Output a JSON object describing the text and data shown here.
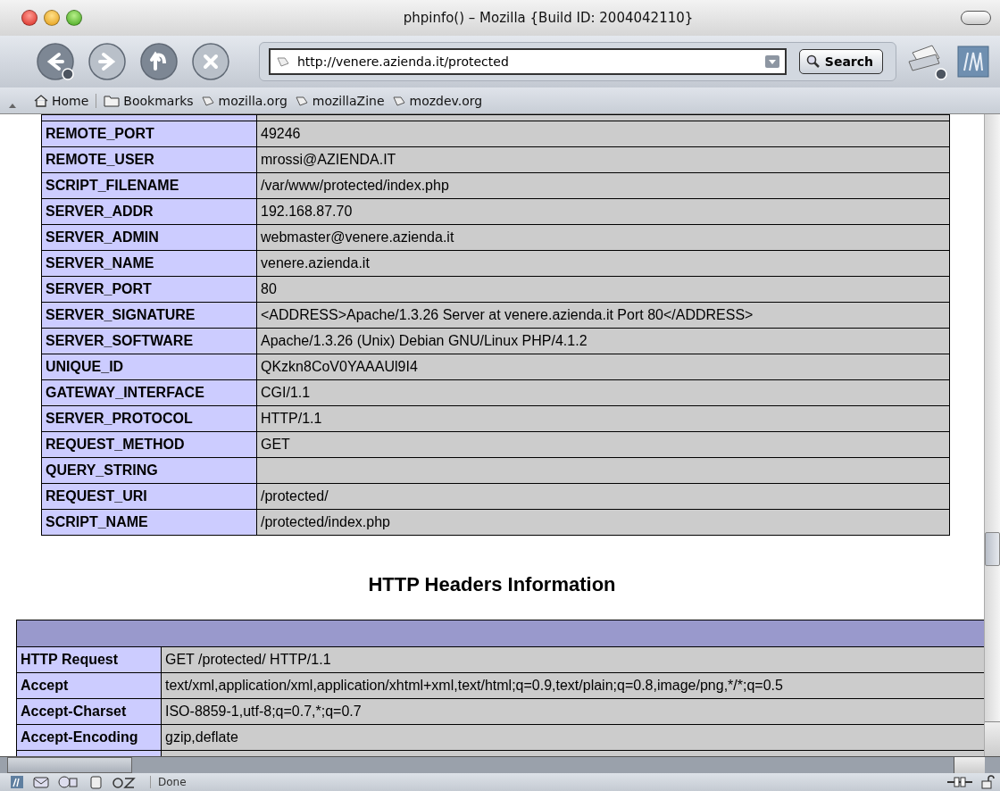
{
  "window": {
    "title": "phpinfo() – Mozilla {Build ID: 2004042110}"
  },
  "nav_buttons": [
    {
      "kind": "back",
      "disabled": false
    },
    {
      "kind": "forward",
      "disabled": true
    },
    {
      "kind": "reload",
      "disabled": false
    },
    {
      "kind": "stop",
      "disabled": true
    }
  ],
  "address_field": {
    "value": "http://venere.azienda.it/protected"
  },
  "search_button": {
    "label": "Search"
  },
  "bookmarks": [
    {
      "kind": "home",
      "label": "Home"
    },
    {
      "kind": "folder",
      "label": "Bookmarks"
    },
    {
      "kind": "link",
      "label": "mozilla.org"
    },
    {
      "kind": "link",
      "label": "mozillaZine"
    },
    {
      "kind": "link",
      "label": "mozdev.org"
    }
  ],
  "environment_table": {
    "rows": [
      [
        "REMOTE_PORT",
        "49246"
      ],
      [
        "REMOTE_USER",
        "mrossi@AZIENDA.IT"
      ],
      [
        "SCRIPT_FILENAME",
        "/var/www/protected/index.php"
      ],
      [
        "SERVER_ADDR",
        "192.168.87.70"
      ],
      [
        "SERVER_ADMIN",
        "webmaster@venere.azienda.it"
      ],
      [
        "SERVER_NAME",
        "venere.azienda.it"
      ],
      [
        "SERVER_PORT",
        "80"
      ],
      [
        "SERVER_SIGNATURE",
        "<ADDRESS>Apache/1.3.26 Server at venere.azienda.it Port 80</ADDRESS>"
      ],
      [
        "SERVER_SOFTWARE",
        "Apache/1.3.26 (Unix) Debian GNU/Linux PHP/4.1.2"
      ],
      [
        "UNIQUE_ID",
        "QKzkn8CoV0YAAAUl9I4"
      ],
      [
        "GATEWAY_INTERFACE",
        "CGI/1.1"
      ],
      [
        "SERVER_PROTOCOL",
        "HTTP/1.1"
      ],
      [
        "REQUEST_METHOD",
        "GET"
      ],
      [
        "QUERY_STRING",
        ""
      ],
      [
        "REQUEST_URI",
        "/protected/"
      ],
      [
        "SCRIPT_NAME",
        "/protected/index.php"
      ]
    ]
  },
  "http_headers": {
    "title": "HTTP Headers Information",
    "rows": [
      [
        "HTTP Request",
        "GET /protected/ HTTP/1.1"
      ],
      [
        "Accept",
        "text/xml,application/xml,application/xhtml+xml,text/html;q=0.9,text/plain;q=0.8,image/png,*/*;q=0.5"
      ],
      [
        "Accept-Charset",
        "ISO-8859-1,utf-8;q=0.7,*;q=0.7"
      ],
      [
        "Accept-Encoding",
        "gzip,deflate"
      ]
    ]
  },
  "status_bar": {
    "text": "Done"
  }
}
